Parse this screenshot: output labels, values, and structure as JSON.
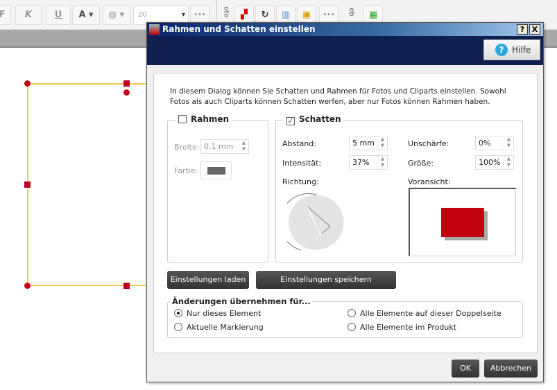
{
  "toolbar": {
    "bold": "F",
    "italic": "K",
    "underline": "U",
    "font_color": "A",
    "font_size": "20",
    "more": "•••",
    "section_foto": "oto",
    "section_web": "eb"
  },
  "dialog": {
    "title": "Rahmen und Schatten einstellen",
    "help_q": "?",
    "close": "X",
    "hilfe": "Hilfe",
    "intro": "In diesem Dialog können Sie Schatten und Rahmen für Fotos und Cliparts einstellen. Sowohl Fotos als auch Cliparts können Schatten werfen, aber nur Fotos können Rahmen haben.",
    "rahmen": {
      "label": "Rahmen",
      "checked": false,
      "breite_label": "Breite:",
      "breite": "0,1 mm",
      "farbe_label": "Farbe:"
    },
    "schatten": {
      "label": "Schatten",
      "checked": true,
      "check": "✓",
      "abstand_label": "Abstand:",
      "abstand": "5 mm",
      "intensitaet_label": "Intensität:",
      "intensitaet": "37%",
      "unschaerfe_label": "Unschärfe:",
      "unschaerfe": "0%",
      "groesse_label": "Größe:",
      "groesse": "100%",
      "richtung_label": "Richtung:",
      "vorschau_label": "Voransicht:",
      "preview_color": "#c0000f"
    },
    "load": "Einstellungen laden",
    "save": "Einstellungen speichern",
    "apply": {
      "title": "Änderungen übernehmen für...",
      "options": [
        "Nur dieses Element",
        "Aktuelle Markierung",
        "Alle Elemente auf dieser Doppelseite",
        "Alle Elemente im Produkt"
      ],
      "selected": 0
    },
    "ok": "OK",
    "cancel": "Abbrechen"
  }
}
